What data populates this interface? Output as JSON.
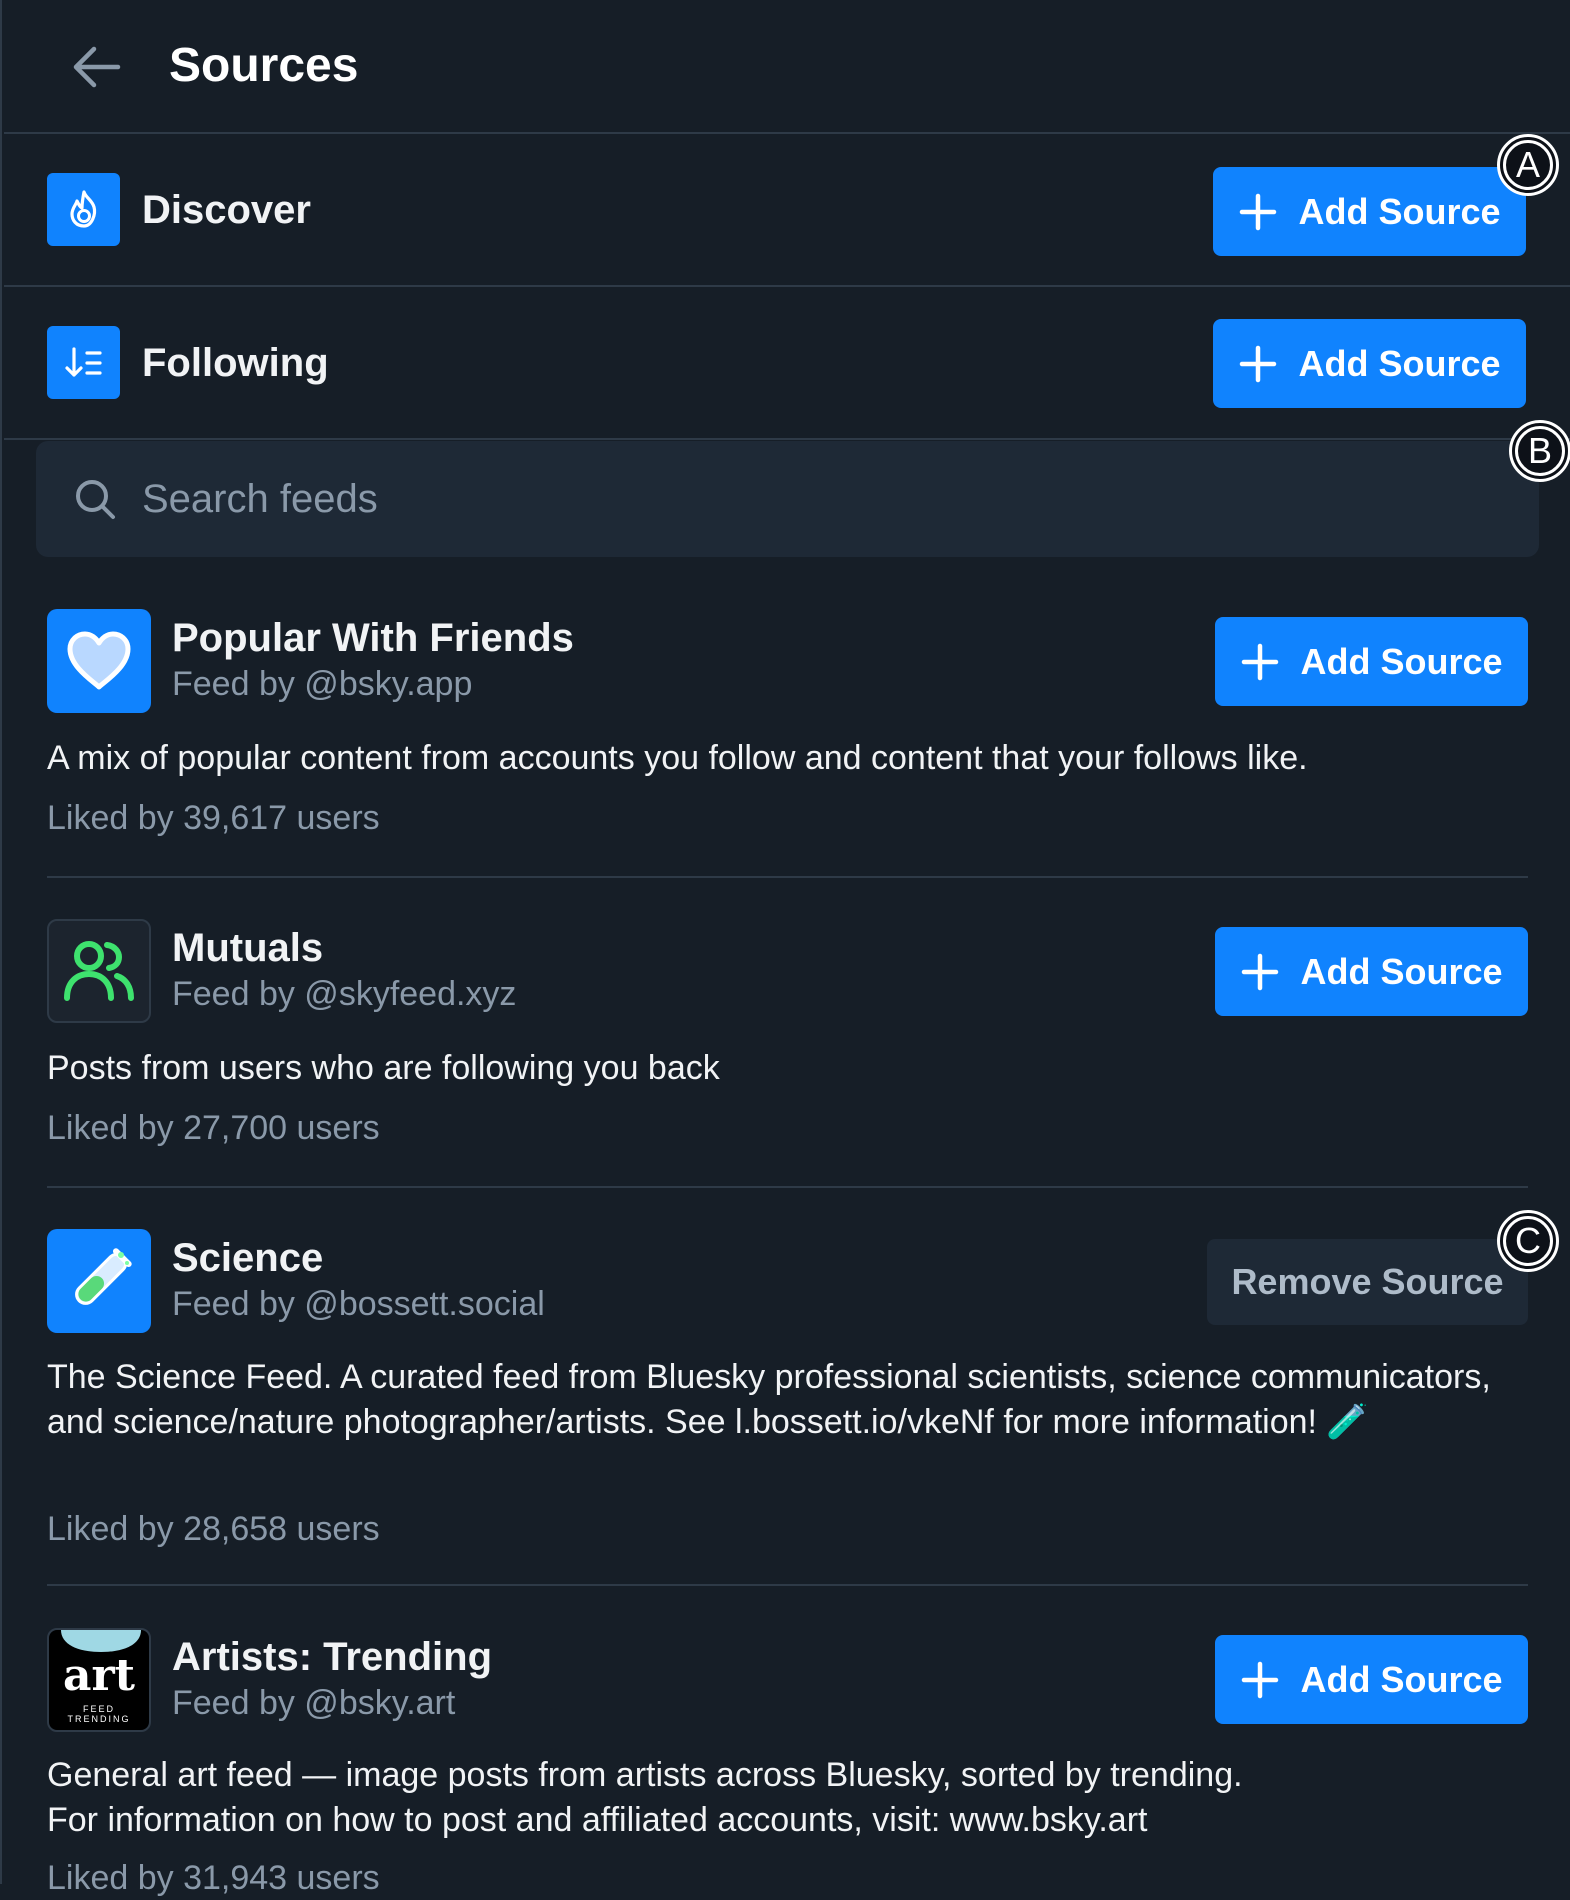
{
  "header": {
    "title": "Sources",
    "back_icon": "arrow-left-icon"
  },
  "pinned": [
    {
      "label": "Discover",
      "icon": "flame-icon",
      "button": "Add Source"
    },
    {
      "label": "Following",
      "icon": "sort-list-icon",
      "button": "Add Source"
    }
  ],
  "search": {
    "placeholder": "Search feeds",
    "value": ""
  },
  "feeds": [
    {
      "name": "Popular With Friends",
      "by": "Feed by @bsky.app",
      "description": "A mix of popular content from accounts you follow and content that your follows like.",
      "likes": "Liked by 39,617 users",
      "button": "Add Source",
      "icon": "heart-icon"
    },
    {
      "name": "Mutuals",
      "by": "Feed by @skyfeed.xyz",
      "description": "Posts from users who are following you back",
      "likes": "Liked by 27,700 users",
      "button": "Add Source",
      "icon": "users-icon"
    },
    {
      "name": "Science",
      "by": "Feed by @bossett.social",
      "description": "The Science Feed. A curated feed from Bluesky professional scientists,  science communicators, and science/nature photographer/artists. See l.bossett.io/vkeNf for more information! 🧪",
      "likes": "Liked by 28,658 users",
      "button": "Remove Source",
      "icon": "test-tube-icon"
    },
    {
      "name": "Artists: Trending",
      "by": "Feed by @bsky.art",
      "description_lines": [
        "General art feed — image posts from artists across Bluesky, sorted by trending.",
        "For information on how to post and affiliated accounts, visit: www.bsky.art"
      ],
      "likes": "Liked by 31,943 users",
      "button": "Add Source",
      "icon": "art-logo",
      "logo_text": "art",
      "logo_sub": "FEED",
      "logo_sub2": "TRENDING"
    }
  ],
  "markers": [
    "A",
    "B",
    "C"
  ],
  "colors": {
    "background": "#161e27",
    "accent": "#1083fe",
    "muted_text": "#8a99a9",
    "divider": "#2e3a47",
    "mutuals_green": "#3ee26e"
  }
}
